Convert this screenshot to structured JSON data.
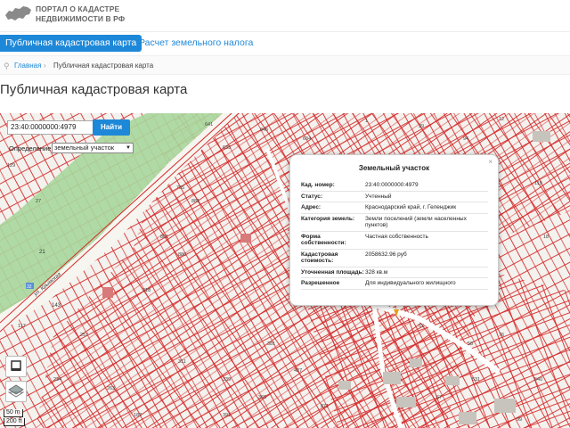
{
  "header": {
    "logo_line1": "ПОРТАЛ О КАДАСТРЕ",
    "logo_line2": "НЕДВИЖИМОСТИ В РФ"
  },
  "nav": {
    "active_tab": "Публичная кадастровая карта",
    "second_tab": "Расчет земельного налога"
  },
  "breadcrumbs": {
    "home": "Главная",
    "separator": "›",
    "current": "Публичная кадастровая карта"
  },
  "page_title": "Публичная кадастровая карта",
  "search": {
    "value": "23:40:0000000:4979",
    "button_label": "Найти"
  },
  "definition": {
    "label": "Определение:",
    "selected": "земельный участок"
  },
  "popup": {
    "title": "Земельный участок",
    "close": "×",
    "rows": [
      {
        "key": "Кад. номер:",
        "value": "23:40:0000000:4979"
      },
      {
        "key": "Статус:",
        "value": "Учтенный"
      },
      {
        "key": "Адрес:",
        "value": "Краснодарский край, г. Геленджик"
      },
      {
        "key": "Категория земель:",
        "value": "Земли поселений (земли населенных пунктов)"
      },
      {
        "key": "Форма собственности:",
        "value": "Частная собственность"
      },
      {
        "key": "Кадастровая стоимость:",
        "value": "2058632.96 руб"
      },
      {
        "key": "Уточненная площадь:",
        "value": "328 кв.м"
      },
      {
        "key": "Разрешенное",
        "value": "Для индивидуального жилищного"
      }
    ]
  },
  "map_labels": {
    "road_name": "ул. Крымская",
    "road_num_1": "21",
    "road_num_2": "143",
    "badge": "32"
  },
  "scale": {
    "metric": "50 m",
    "imperial": "200 ft"
  },
  "colors": {
    "accent": "#1e88d8",
    "parcel_line": "#d42a2a",
    "green_strip": "#a8d79c"
  }
}
